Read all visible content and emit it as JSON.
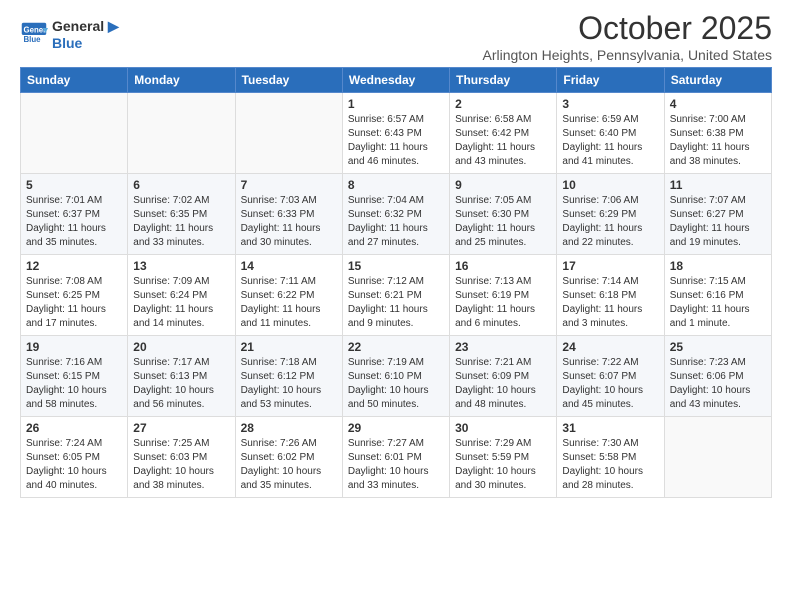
{
  "header": {
    "logo": {
      "line1": "General",
      "line2": "Blue"
    },
    "month": "October 2025",
    "location": "Arlington Heights, Pennsylvania, United States"
  },
  "days_of_week": [
    "Sunday",
    "Monday",
    "Tuesday",
    "Wednesday",
    "Thursday",
    "Friday",
    "Saturday"
  ],
  "weeks": [
    [
      {
        "day": "",
        "info": ""
      },
      {
        "day": "",
        "info": ""
      },
      {
        "day": "",
        "info": ""
      },
      {
        "day": "1",
        "info": "Sunrise: 6:57 AM\nSunset: 6:43 PM\nDaylight: 11 hours\nand 46 minutes."
      },
      {
        "day": "2",
        "info": "Sunrise: 6:58 AM\nSunset: 6:42 PM\nDaylight: 11 hours\nand 43 minutes."
      },
      {
        "day": "3",
        "info": "Sunrise: 6:59 AM\nSunset: 6:40 PM\nDaylight: 11 hours\nand 41 minutes."
      },
      {
        "day": "4",
        "info": "Sunrise: 7:00 AM\nSunset: 6:38 PM\nDaylight: 11 hours\nand 38 minutes."
      }
    ],
    [
      {
        "day": "5",
        "info": "Sunrise: 7:01 AM\nSunset: 6:37 PM\nDaylight: 11 hours\nand 35 minutes."
      },
      {
        "day": "6",
        "info": "Sunrise: 7:02 AM\nSunset: 6:35 PM\nDaylight: 11 hours\nand 33 minutes."
      },
      {
        "day": "7",
        "info": "Sunrise: 7:03 AM\nSunset: 6:33 PM\nDaylight: 11 hours\nand 30 minutes."
      },
      {
        "day": "8",
        "info": "Sunrise: 7:04 AM\nSunset: 6:32 PM\nDaylight: 11 hours\nand 27 minutes."
      },
      {
        "day": "9",
        "info": "Sunrise: 7:05 AM\nSunset: 6:30 PM\nDaylight: 11 hours\nand 25 minutes."
      },
      {
        "day": "10",
        "info": "Sunrise: 7:06 AM\nSunset: 6:29 PM\nDaylight: 11 hours\nand 22 minutes."
      },
      {
        "day": "11",
        "info": "Sunrise: 7:07 AM\nSunset: 6:27 PM\nDaylight: 11 hours\nand 19 minutes."
      }
    ],
    [
      {
        "day": "12",
        "info": "Sunrise: 7:08 AM\nSunset: 6:25 PM\nDaylight: 11 hours\nand 17 minutes."
      },
      {
        "day": "13",
        "info": "Sunrise: 7:09 AM\nSunset: 6:24 PM\nDaylight: 11 hours\nand 14 minutes."
      },
      {
        "day": "14",
        "info": "Sunrise: 7:11 AM\nSunset: 6:22 PM\nDaylight: 11 hours\nand 11 minutes."
      },
      {
        "day": "15",
        "info": "Sunrise: 7:12 AM\nSunset: 6:21 PM\nDaylight: 11 hours\nand 9 minutes."
      },
      {
        "day": "16",
        "info": "Sunrise: 7:13 AM\nSunset: 6:19 PM\nDaylight: 11 hours\nand 6 minutes."
      },
      {
        "day": "17",
        "info": "Sunrise: 7:14 AM\nSunset: 6:18 PM\nDaylight: 11 hours\nand 3 minutes."
      },
      {
        "day": "18",
        "info": "Sunrise: 7:15 AM\nSunset: 6:16 PM\nDaylight: 11 hours\nand 1 minute."
      }
    ],
    [
      {
        "day": "19",
        "info": "Sunrise: 7:16 AM\nSunset: 6:15 PM\nDaylight: 10 hours\nand 58 minutes."
      },
      {
        "day": "20",
        "info": "Sunrise: 7:17 AM\nSunset: 6:13 PM\nDaylight: 10 hours\nand 56 minutes."
      },
      {
        "day": "21",
        "info": "Sunrise: 7:18 AM\nSunset: 6:12 PM\nDaylight: 10 hours\nand 53 minutes."
      },
      {
        "day": "22",
        "info": "Sunrise: 7:19 AM\nSunset: 6:10 PM\nDaylight: 10 hours\nand 50 minutes."
      },
      {
        "day": "23",
        "info": "Sunrise: 7:21 AM\nSunset: 6:09 PM\nDaylight: 10 hours\nand 48 minutes."
      },
      {
        "day": "24",
        "info": "Sunrise: 7:22 AM\nSunset: 6:07 PM\nDaylight: 10 hours\nand 45 minutes."
      },
      {
        "day": "25",
        "info": "Sunrise: 7:23 AM\nSunset: 6:06 PM\nDaylight: 10 hours\nand 43 minutes."
      }
    ],
    [
      {
        "day": "26",
        "info": "Sunrise: 7:24 AM\nSunset: 6:05 PM\nDaylight: 10 hours\nand 40 minutes."
      },
      {
        "day": "27",
        "info": "Sunrise: 7:25 AM\nSunset: 6:03 PM\nDaylight: 10 hours\nand 38 minutes."
      },
      {
        "day": "28",
        "info": "Sunrise: 7:26 AM\nSunset: 6:02 PM\nDaylight: 10 hours\nand 35 minutes."
      },
      {
        "day": "29",
        "info": "Sunrise: 7:27 AM\nSunset: 6:01 PM\nDaylight: 10 hours\nand 33 minutes."
      },
      {
        "day": "30",
        "info": "Sunrise: 7:29 AM\nSunset: 5:59 PM\nDaylight: 10 hours\nand 30 minutes."
      },
      {
        "day": "31",
        "info": "Sunrise: 7:30 AM\nSunset: 5:58 PM\nDaylight: 10 hours\nand 28 minutes."
      },
      {
        "day": "",
        "info": ""
      }
    ]
  ]
}
